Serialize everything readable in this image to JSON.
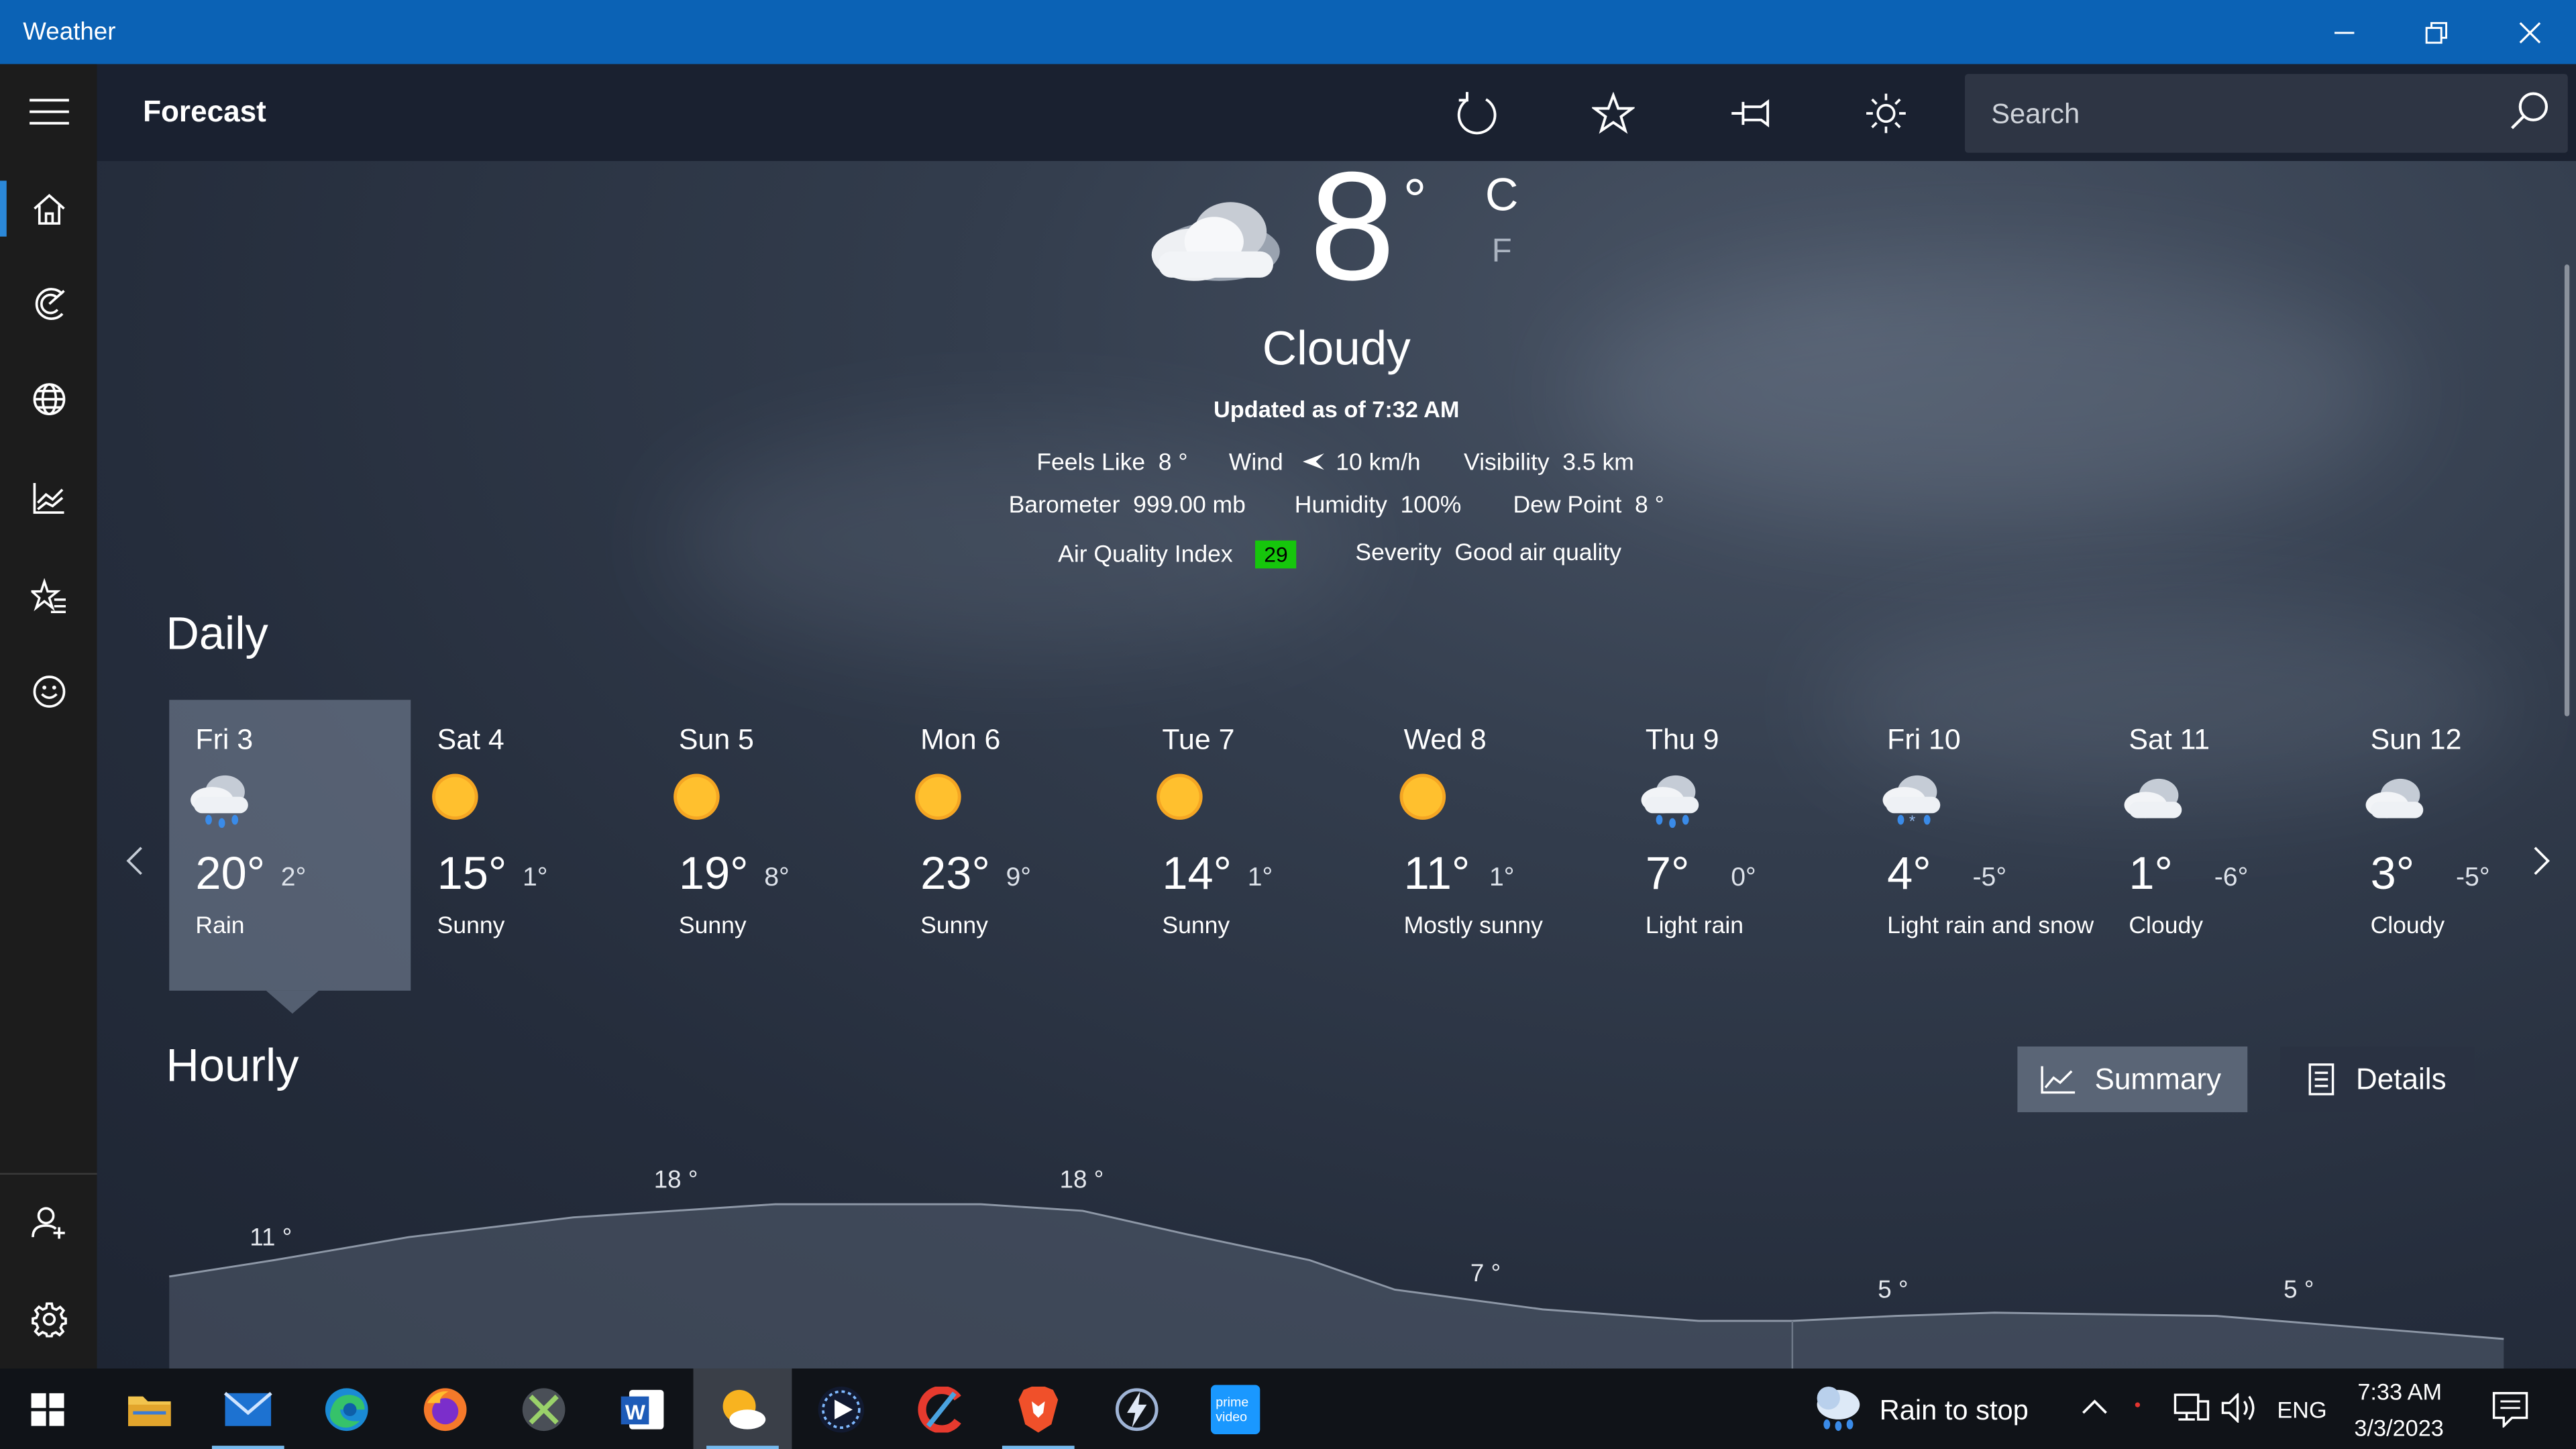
{
  "window": {
    "title": "Weather"
  },
  "command_bar": {
    "title": "Forecast",
    "search_placeholder": "Search"
  },
  "current": {
    "temperature": "8",
    "degree_symbol": "°",
    "unit_celsius": "C",
    "unit_fahrenheit": "F",
    "condition": "Cloudy",
    "updated": "Updated as of 7:32 AM",
    "details": {
      "feels_like_label": "Feels Like",
      "feels_like_value": "8 °",
      "wind_label": "Wind",
      "wind_value": "10 km/h",
      "visibility_label": "Visibility",
      "visibility_value": "3.5 km",
      "barometer_label": "Barometer",
      "barometer_value": "999.00 mb",
      "humidity_label": "Humidity",
      "humidity_value": "100%",
      "dew_point_label": "Dew Point",
      "dew_point_value": "8 °",
      "aqi_label": "Air Quality Index",
      "aqi_value": "29",
      "severity_label": "Severity",
      "severity_value": "Good air quality"
    }
  },
  "daily": {
    "title": "Daily",
    "days": [
      {
        "name": "Fri 3",
        "hi": "20°",
        "lo": "2°",
        "cond": "Rain",
        "icon": "rain-icon"
      },
      {
        "name": "Sat 4",
        "hi": "15°",
        "lo": "1°",
        "cond": "Sunny",
        "icon": "sun-icon"
      },
      {
        "name": "Sun 5",
        "hi": "19°",
        "lo": "8°",
        "cond": "Sunny",
        "icon": "sun-icon"
      },
      {
        "name": "Mon 6",
        "hi": "23°",
        "lo": "9°",
        "cond": "Sunny",
        "icon": "sun-icon"
      },
      {
        "name": "Tue 7",
        "hi": "14°",
        "lo": "1°",
        "cond": "Sunny",
        "icon": "sun-icon"
      },
      {
        "name": "Wed 8",
        "hi": "11°",
        "lo": "1°",
        "cond": "Mostly sunny",
        "icon": "sun-icon"
      },
      {
        "name": "Thu 9",
        "hi": "7°",
        "lo": "0°",
        "cond": "Light rain",
        "icon": "rain-icon"
      },
      {
        "name": "Fri 10",
        "hi": "4°",
        "lo": "-5°",
        "cond": "Light rain and snow",
        "icon": "rain-snow-icon"
      },
      {
        "name": "Sat 11",
        "hi": "1°",
        "lo": "-6°",
        "cond": "Cloudy",
        "icon": "cloud-icon"
      },
      {
        "name": "Sun 12",
        "hi": "3°",
        "lo": "-5°",
        "cond": "Cloudy",
        "icon": "cloud-icon"
      }
    ]
  },
  "hourly": {
    "title": "Hourly",
    "summary_label": "Summary",
    "details_label": "Details",
    "labels": [
      "11 °",
      "18 °",
      "18 °",
      "7 °",
      "5 °",
      "5 °"
    ]
  },
  "taskbar": {
    "notification_text": "Rain to stop",
    "language": "ENG",
    "time": "7:33 AM",
    "date": "3/3/2023"
  },
  "colors": {
    "accent": "#0b62b5",
    "aqi_good": "#16c60c"
  }
}
